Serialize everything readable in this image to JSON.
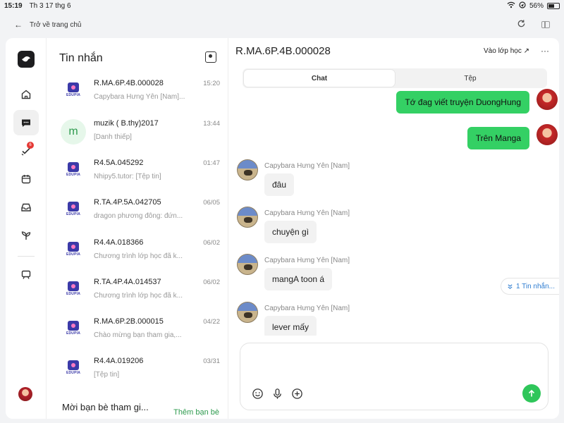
{
  "status_bar": {
    "time": "15:19",
    "date": "Th 3 17 thg 6",
    "battery": "56%"
  },
  "topbar": {
    "back_label": "Trở về trang chủ"
  },
  "rail": {
    "todo_badge": "6"
  },
  "list": {
    "title": "Tin nhắn",
    "conversations": [
      {
        "name": "R.MA.6P.4B.000028",
        "preview": "Capybara Hưng Yên [Nam]...",
        "time": "15:20",
        "avatar": "edupia"
      },
      {
        "name": "muzik ( B.thy)2017",
        "preview": "[Danh thiếp]",
        "time": "13:44",
        "avatar": "letter",
        "letter": "m"
      },
      {
        "name": "R4.5A.045292",
        "preview": "Nhipy5.tutor: [Tệp tin]",
        "time": "01:47",
        "avatar": "edupia"
      },
      {
        "name": "R.TA.4P.5A.042705",
        "preview": "dragon phương đông: đứn...",
        "time": "06/05",
        "avatar": "edupia"
      },
      {
        "name": "R4.4A.018366",
        "preview": "Chương trình lớp học đã k...",
        "time": "06/02",
        "avatar": "edupia"
      },
      {
        "name": "R.TA.4P.4A.014537",
        "preview": "Chương trình lớp học đã k...",
        "time": "06/02",
        "avatar": "edupia"
      },
      {
        "name": "R.MA.6P.2B.000015",
        "preview": "Chào mừng bạn tham gia,...",
        "time": "04/22",
        "avatar": "edupia"
      },
      {
        "name": "R4.4A.019206",
        "preview": "[Tệp tin]",
        "time": "03/31",
        "avatar": "edupia"
      }
    ],
    "invite_text": "Mời bạn bè tham gi...",
    "add_friend": "Thêm bạn bè",
    "edupia_logo_text": "EDUPIA"
  },
  "chat": {
    "title": "R.MA.6P.4B.000028",
    "join_class": "Vào lớp học ↗",
    "more": "···",
    "tabs": [
      {
        "label": "Chat",
        "active": true
      },
      {
        "label": "Tệp",
        "active": false
      }
    ],
    "outgoing": [
      "Tớ đag viết truyện DuongHung",
      "Trên Manga"
    ],
    "incoming": [
      {
        "sender": "Capybara Hưng Yên [Nam]",
        "text": "đâu"
      },
      {
        "sender": "Capybara Hưng Yên [Nam]",
        "text": "chuyện gì"
      },
      {
        "sender": "Capybara Hưng Yên [Nam]",
        "text": "mangA toon á"
      },
      {
        "sender": "Capybara Hưng Yên [Nam]",
        "text": "lever mấy"
      }
    ],
    "new_messages": "1 Tin nhắn...",
    "composer_value": ""
  },
  "colors": {
    "accent_green": "#34d064",
    "send_green": "#2fc65a",
    "badge_red": "#e53935",
    "link_blue": "#2e7dd1"
  }
}
